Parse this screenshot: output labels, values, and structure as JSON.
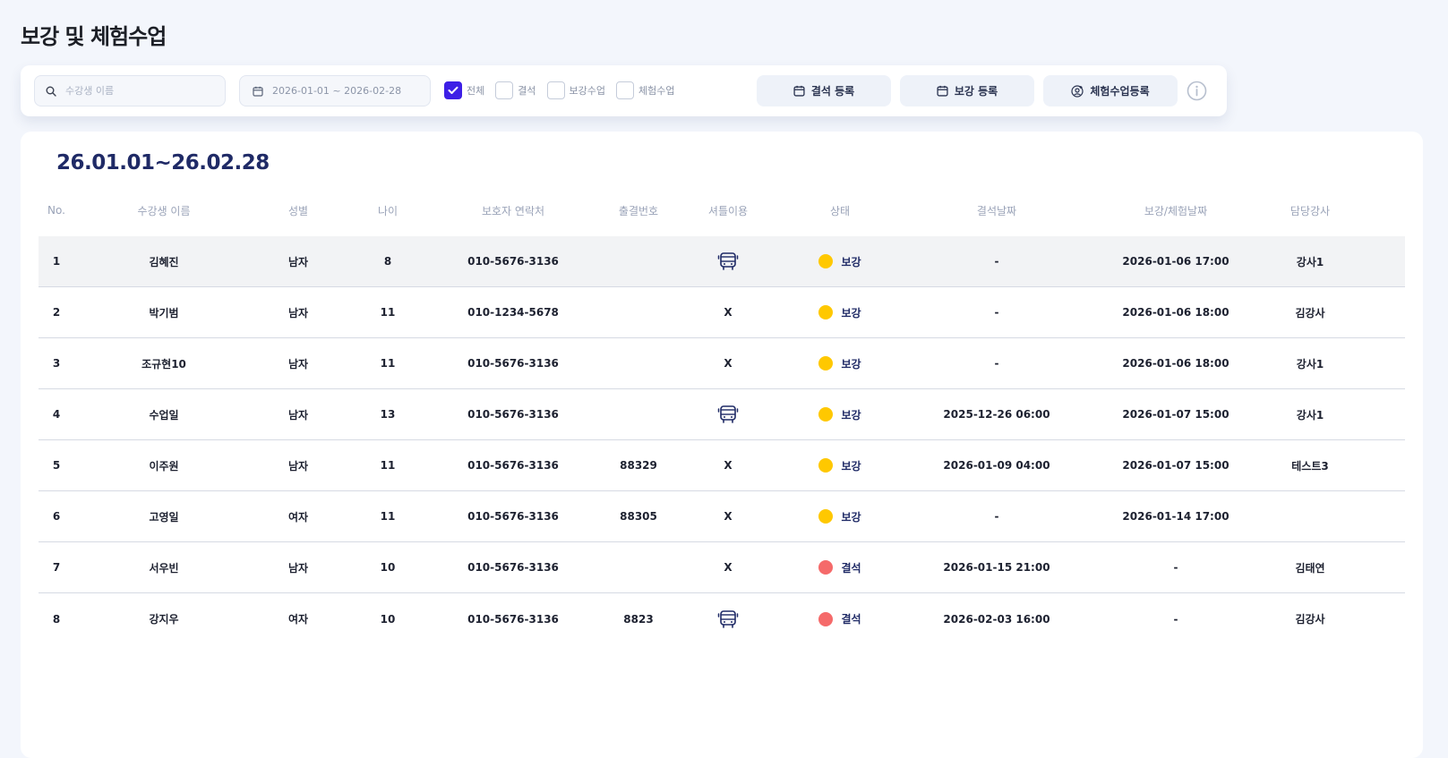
{
  "page": {
    "title": "보강 및 체험수업"
  },
  "toolbar": {
    "search_placeholder": "수강생 이름",
    "search_value": "",
    "date_range": "2026-01-01 ~ 2026-02-28",
    "filters": [
      {
        "label": "전체",
        "checked": true
      },
      {
        "label": "결석",
        "checked": false
      },
      {
        "label": "보강수업",
        "checked": false
      },
      {
        "label": "체험수업",
        "checked": false
      }
    ],
    "buttons": {
      "absence": "결석 등록",
      "makeup": "보강 등록",
      "trial": "체험수업등록"
    }
  },
  "panel": {
    "range_title": "26.01.01~26.02.28",
    "columns": [
      "No.",
      "수강생 이름",
      "성별",
      "나이",
      "보호자 연락처",
      "출결번호",
      "셔틀이용",
      "상태",
      "결석날짜",
      "보강/체험날짜",
      "담당강사"
    ],
    "rows": [
      {
        "no": "1",
        "name": "김혜진",
        "gender": "남자",
        "age": "8",
        "phone": "010-5676-3136",
        "attend": "",
        "shuttle": "bus",
        "status": "보강",
        "absent": "-",
        "makeup": "2026-01-06 17:00",
        "teacher": "강사1"
      },
      {
        "no": "2",
        "name": "박기범",
        "gender": "남자",
        "age": "11",
        "phone": "010-1234-5678",
        "attend": "",
        "shuttle": "X",
        "status": "보강",
        "absent": "-",
        "makeup": "2026-01-06 18:00",
        "teacher": "김강사"
      },
      {
        "no": "3",
        "name": "조규현10",
        "gender": "남자",
        "age": "11",
        "phone": "010-5676-3136",
        "attend": "",
        "shuttle": "X",
        "status": "보강",
        "absent": "-",
        "makeup": "2026-01-06 18:00",
        "teacher": "강사1"
      },
      {
        "no": "4",
        "name": "수업일",
        "gender": "남자",
        "age": "13",
        "phone": "010-5676-3136",
        "attend": "",
        "shuttle": "bus",
        "status": "보강",
        "absent": "2025-12-26 06:00",
        "makeup": "2026-01-07 15:00",
        "teacher": "강사1"
      },
      {
        "no": "5",
        "name": "이주원",
        "gender": "남자",
        "age": "11",
        "phone": "010-5676-3136",
        "attend": "88329",
        "shuttle": "X",
        "status": "보강",
        "absent": "2026-01-09 04:00",
        "makeup": "2026-01-07 15:00",
        "teacher": "테스트3"
      },
      {
        "no": "6",
        "name": "고영일",
        "gender": "여자",
        "age": "11",
        "phone": "010-5676-3136",
        "attend": "88305",
        "shuttle": "X",
        "status": "보강",
        "absent": "-",
        "makeup": "2026-01-14 17:00",
        "teacher": ""
      },
      {
        "no": "7",
        "name": "서우빈",
        "gender": "남자",
        "age": "10",
        "phone": "010-5676-3136",
        "attend": "",
        "shuttle": "X",
        "status": "결석",
        "absent": "2026-01-15 21:00",
        "makeup": "-",
        "teacher": "김태연"
      },
      {
        "no": "8",
        "name": "강지우",
        "gender": "여자",
        "age": "10",
        "phone": "010-5676-3136",
        "attend": "8823",
        "shuttle": "bus",
        "status": "결석",
        "absent": "2026-02-03 16:00",
        "makeup": "-",
        "teacher": "김강사"
      }
    ]
  },
  "colors": {
    "accent": "#3d1fe6",
    "makeup_dot": "#ffc800",
    "absent_dot": "#f56a6a",
    "navy": "#1f2a66"
  },
  "icons": {
    "search": "search-icon",
    "calendar": "calendar-icon",
    "trial": "user-add-icon",
    "info": "info-icon",
    "shuttle": "bus-icon"
  }
}
